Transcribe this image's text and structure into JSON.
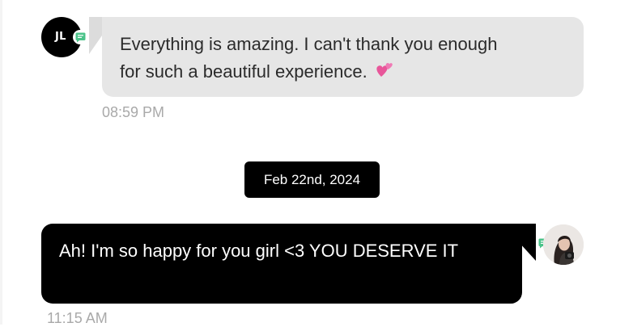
{
  "incoming_message": {
    "avatar_initials": "JL",
    "text": "Everything is amazing. I can't thank you enough for such a beautiful experience.",
    "emoji_icon": "two-hearts-icon",
    "time": "08:59 PM",
    "bubble_color": "#e6e6e6",
    "badge_icon": "message-icon",
    "badge_color": "#4cc38a"
  },
  "date_separator": {
    "label": "Feb 22nd, 2024"
  },
  "outgoing_message": {
    "text": "Ah! I'm so happy for you girl <3 YOU DESERVE IT",
    "time": "11:15 AM",
    "bubble_color": "#000000",
    "badge_icon": "message-icon",
    "badge_color": "#4cc38a"
  }
}
